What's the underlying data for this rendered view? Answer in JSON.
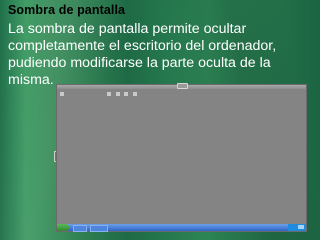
{
  "slide": {
    "title": "Sombra de pantalla",
    "body": "La sombra de pantalla permite ocultar completamente el escritorio del ordenador, pudiendo modificarse la parte oculta de la misma."
  },
  "screenshot": {
    "shade_color": "#848484",
    "taskbar_color": "#2f64c6",
    "start_button_color": "#2f8a2c"
  }
}
